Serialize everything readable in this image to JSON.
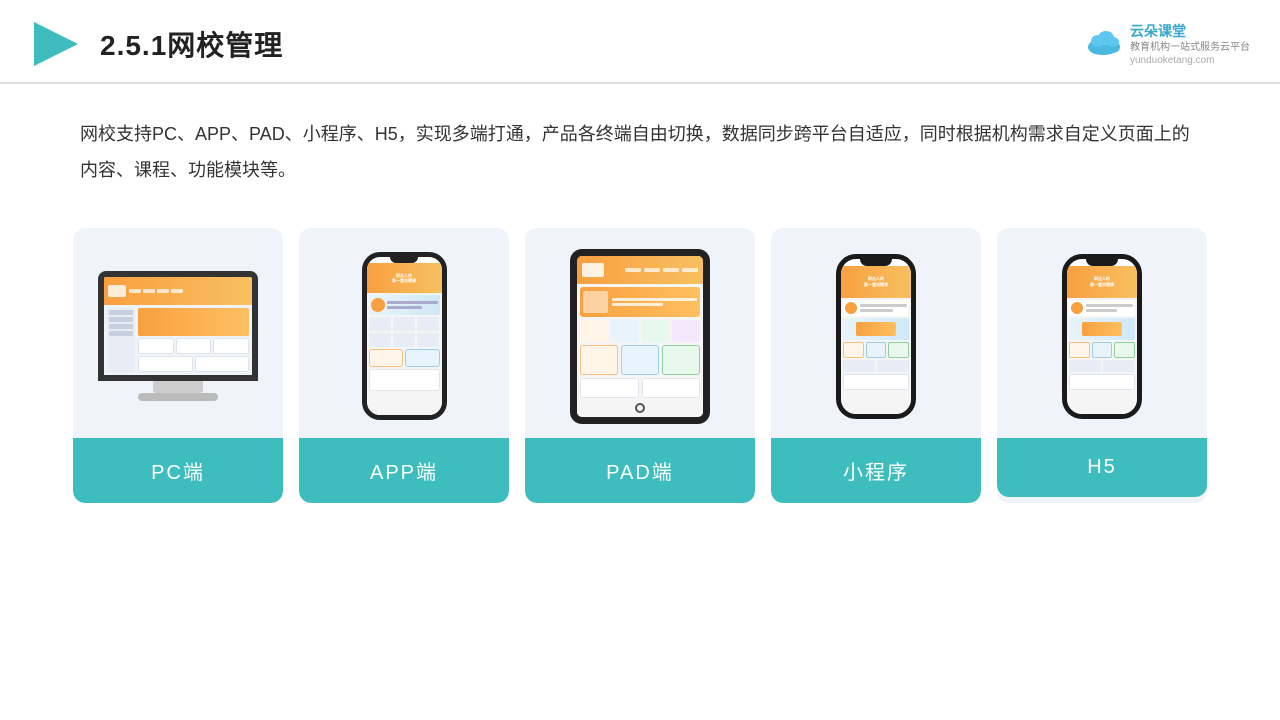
{
  "header": {
    "title": "2.5.1网校管理",
    "logo": {
      "brand": "云朵课堂",
      "url": "yunduoketang.com",
      "tagline": "教育机构一站式服务云平台"
    }
  },
  "description": "网校支持PC、APP、PAD、小程序、H5，实现多端打通，产品各终端自由切换，数据同步跨平台自适应，同时根据机构需求自定义页面上的内容、课程、功能模块等。",
  "cards": [
    {
      "id": "pc",
      "label": "PC端"
    },
    {
      "id": "app",
      "label": "APP端"
    },
    {
      "id": "pad",
      "label": "PAD端"
    },
    {
      "id": "miniapp",
      "label": "小程序"
    },
    {
      "id": "h5",
      "label": "H5"
    }
  ],
  "colors": {
    "accent": "#3dbdbd",
    "bg_card": "#f0f4fa",
    "title": "#222222",
    "text": "#333333"
  }
}
